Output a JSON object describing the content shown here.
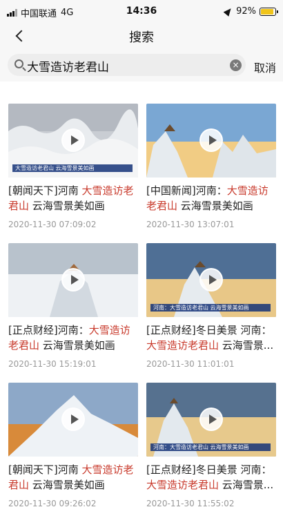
{
  "status_bar": {
    "carrier": "中国联通",
    "network": "4G",
    "time": "14:36",
    "battery_text": "92%",
    "battery_level": 0.92
  },
  "nav": {
    "title": "搜索"
  },
  "search": {
    "query": "大雪造访老君山",
    "clear_symbol": "×",
    "cancel_label": "取消"
  },
  "colors": {
    "highlight": "#c8392b",
    "date": "#999999",
    "background": "#f7f7f7"
  },
  "results": [
    {
      "prefix": "[朝闻天下]河南 ",
      "highlight": "大雪造访老君山",
      "suffix": " 云海雪景美如画",
      "date": "2020-11-30 07:09:02",
      "caption": "大雪造访老君山 云海雪景美如画"
    },
    {
      "prefix": "[中国新闻]河南：",
      "highlight": "大雪造访老君山",
      "suffix": " 云海雪景美如画",
      "date": "2020-11-30 13:07:01",
      "caption": ""
    },
    {
      "prefix": "[正点财经]河南：",
      "highlight": "大雪造访老君山",
      "suffix": " 云海雪景美如画",
      "date": "2020-11-30 15:19:01",
      "caption": ""
    },
    {
      "prefix": "[正点财经]冬日美景 河南：",
      "highlight": "大雪造访老君山",
      "suffix": " 云海雪景...",
      "date": "2020-11-30 11:01:01",
      "caption": "河南：大雪造访老君山 云海雪景美如画"
    },
    {
      "prefix": "[朝闻天下]河南 ",
      "highlight": "大雪造访老君山",
      "suffix": " 云海雪景美如画",
      "date": "2020-11-30 09:26:02",
      "caption": ""
    },
    {
      "prefix": "[正点财经]冬日美景 河南：",
      "highlight": "大雪造访老君山",
      "suffix": " 云海雪景...",
      "date": "2020-11-30 11:55:02",
      "caption": "河南：大雪造访老君山 云海雪景美如画"
    }
  ]
}
